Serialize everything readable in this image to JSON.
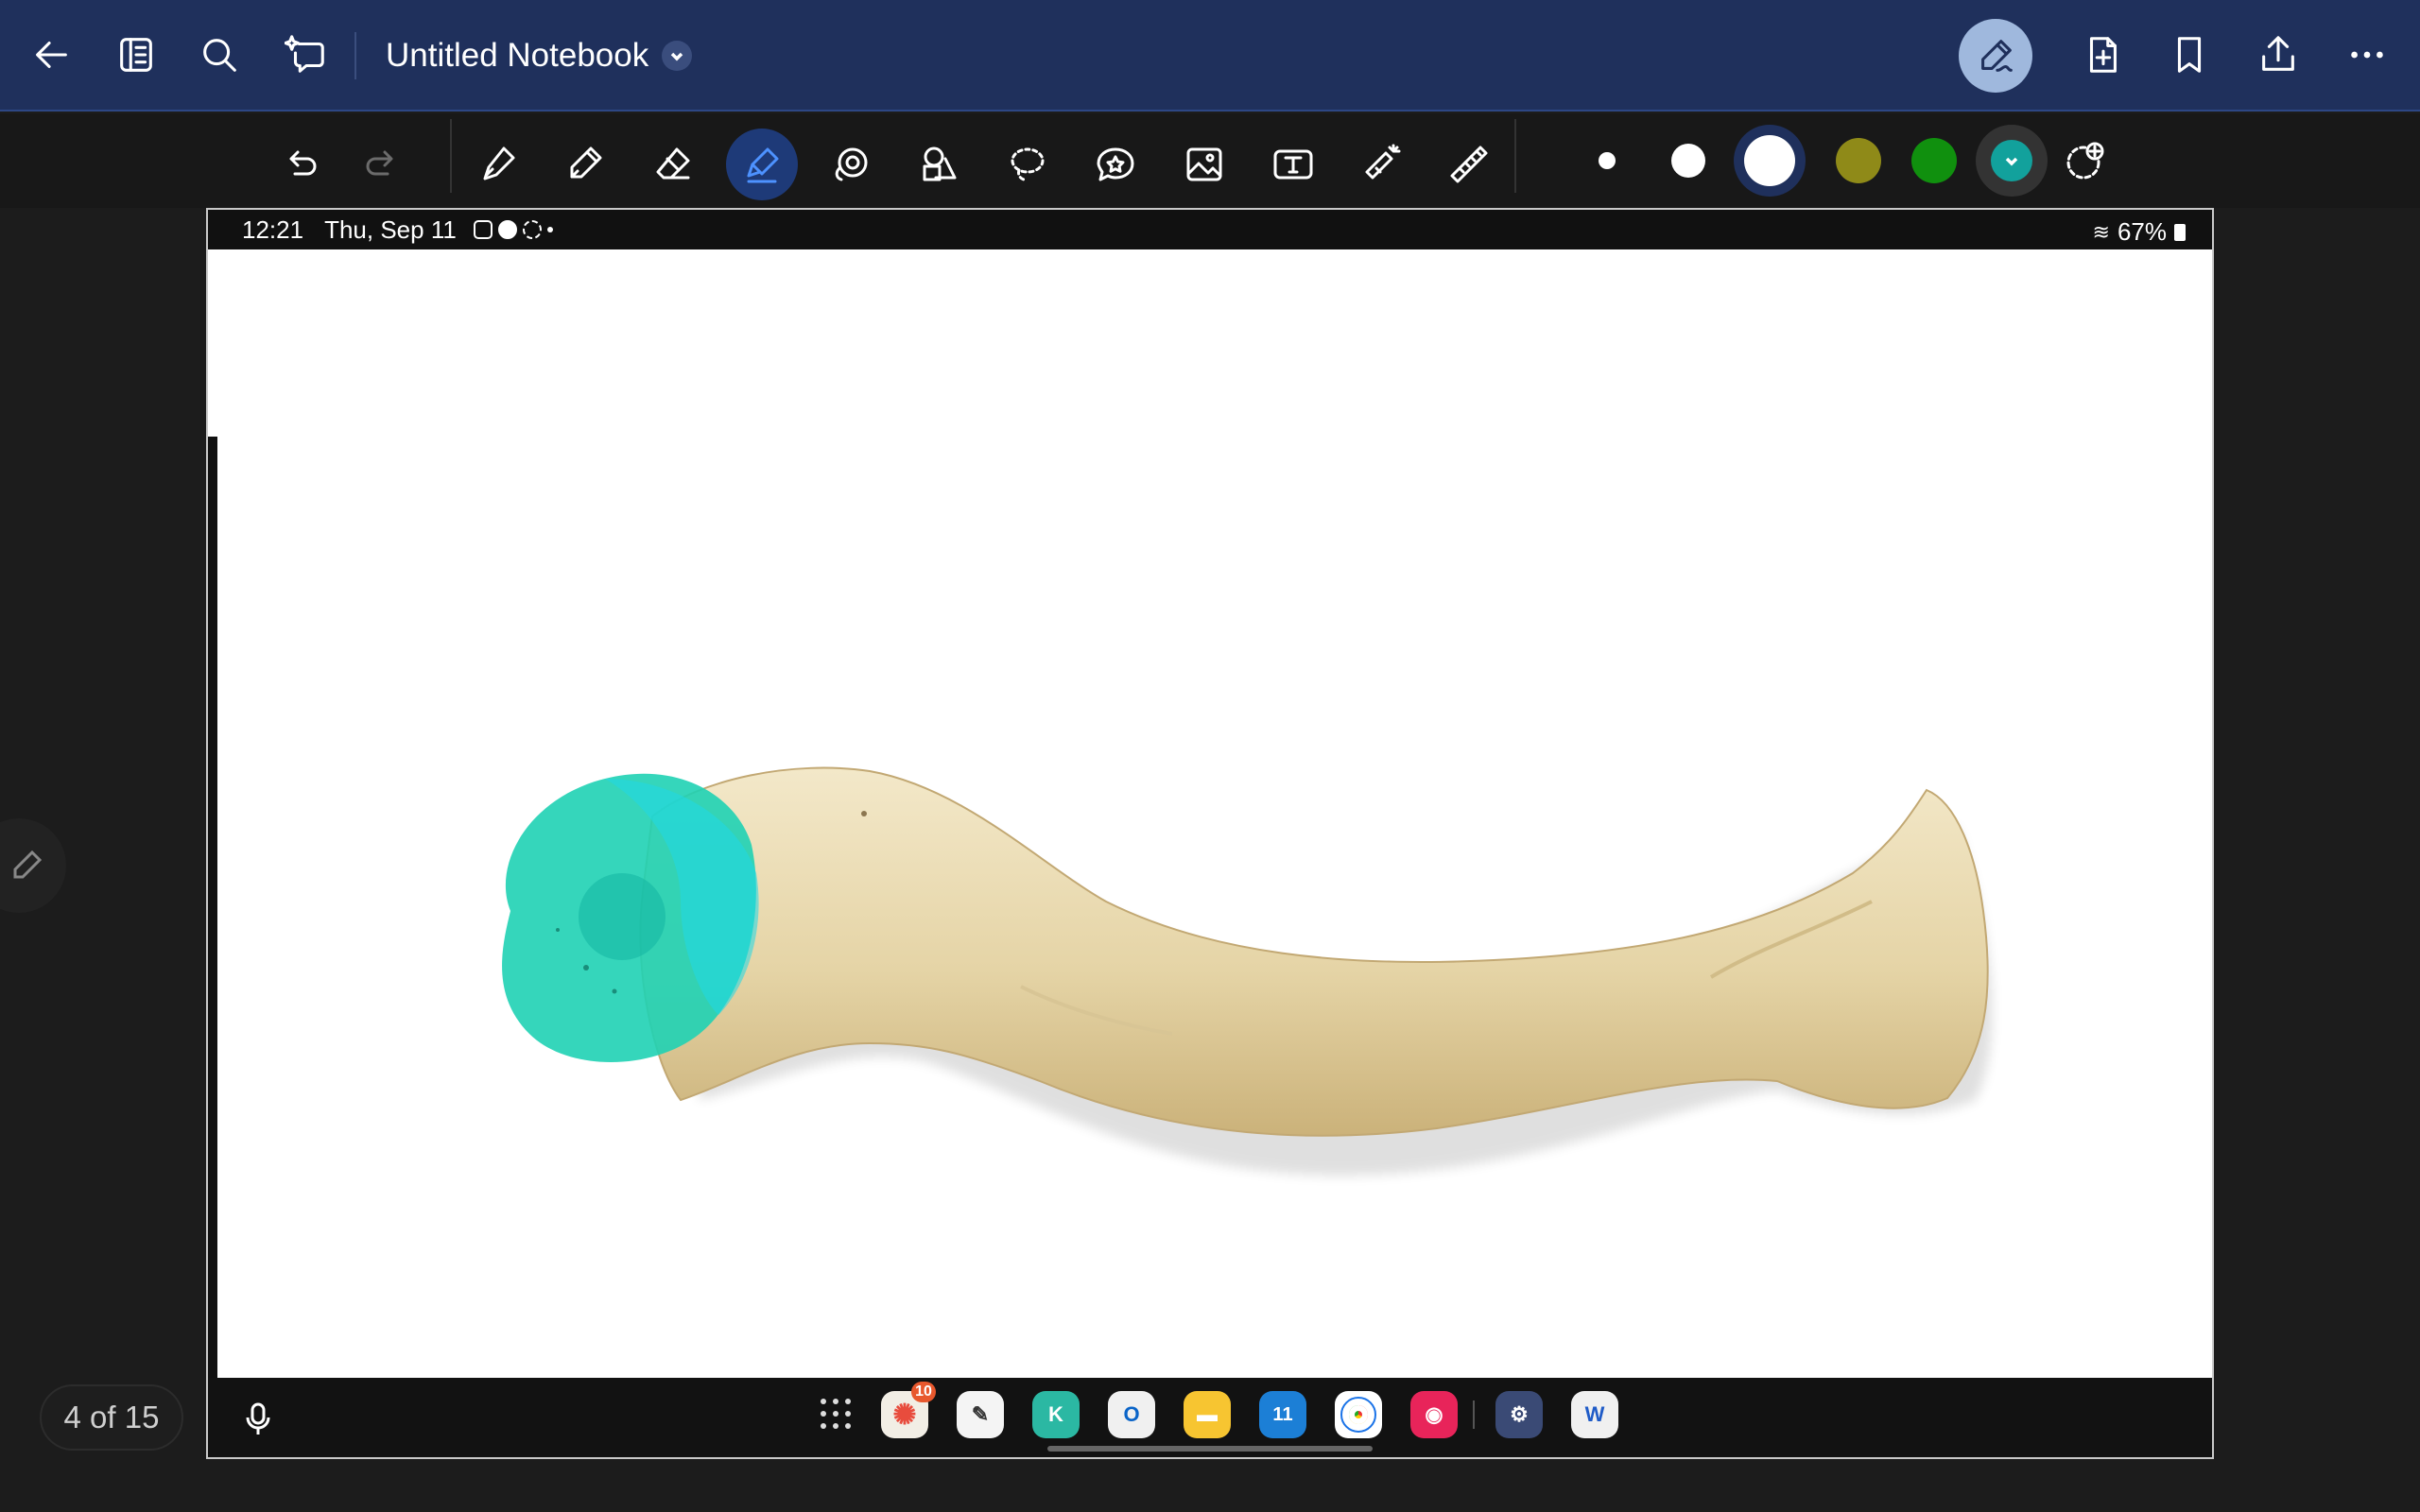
{
  "header": {
    "title": "Untitled Notebook",
    "icons": [
      "back-arrow-icon",
      "sidebar-panel-icon",
      "search-icon",
      "ai-assist-icon",
      "chevron-down-icon",
      "pen-mode-icon",
      "add-page-icon",
      "bookmark-icon",
      "share-icon",
      "more-icon"
    ]
  },
  "toolbar": {
    "tools": [
      "undo-icon",
      "redo-icon",
      "fountain-pen-icon",
      "pencil-icon",
      "eraser-icon",
      "highlighter-icon",
      "lasso-shape-icon",
      "shapes-icon",
      "lasso-icon",
      "sticker-icon",
      "image-icon",
      "text-box-icon",
      "laser-pointer-icon",
      "ruler-icon"
    ],
    "active_tool": "highlighter-icon",
    "stroke_sizes": [
      "small",
      "medium",
      "large"
    ],
    "selected_size": "large",
    "colors": [
      "#8f8a18",
      "#10900e",
      "#12a19c"
    ],
    "selected_color": "#12a19c"
  },
  "screenshot": {
    "status_time": "12:21",
    "status_date": "Thu, Sep 11",
    "battery": "67%",
    "dock_badge": "10",
    "calendar_day": "11",
    "highlight_color": "#1fd1b4"
  },
  "pager": {
    "label": "4 of 15"
  }
}
